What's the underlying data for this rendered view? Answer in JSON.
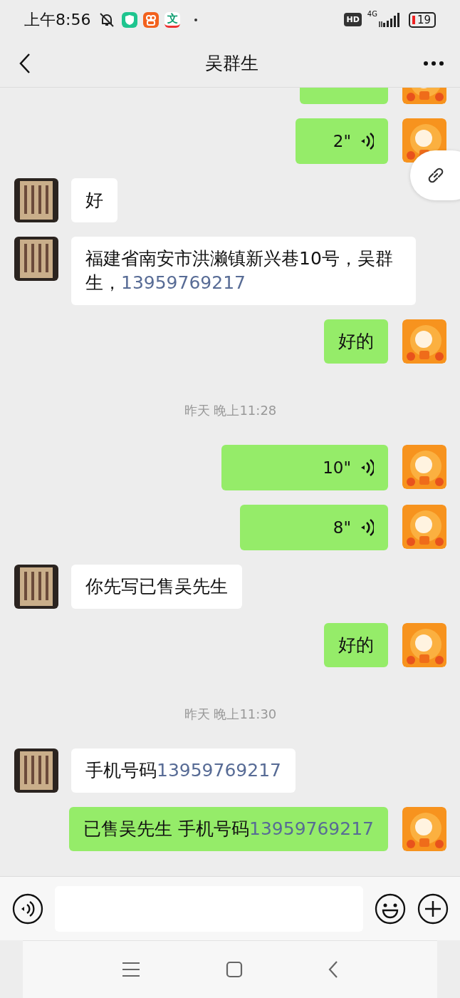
{
  "status_bar": {
    "time": "上午8:56",
    "app_badge": "文",
    "hd": "HD",
    "network": "4G",
    "battery": "19"
  },
  "header": {
    "title": "吴群生"
  },
  "messages": [
    {
      "outgoing": true,
      "kind": "clipped"
    },
    {
      "outgoing": true,
      "kind": "voice",
      "duration": "2\""
    },
    {
      "outgoing": false,
      "kind": "text",
      "text": "好"
    },
    {
      "outgoing": false,
      "kind": "text",
      "text": "福建省南安市洪濑镇新兴巷10号，吴群生，",
      "phone": "13959769217"
    },
    {
      "outgoing": true,
      "kind": "text",
      "text": "好的"
    },
    {
      "kind": "time",
      "text": "昨天 晚上11:28"
    },
    {
      "outgoing": true,
      "kind": "voice",
      "duration": "10\""
    },
    {
      "outgoing": true,
      "kind": "voice",
      "duration": "8\""
    },
    {
      "outgoing": false,
      "kind": "text",
      "text": "你先写已售吴先生"
    },
    {
      "outgoing": true,
      "kind": "text",
      "text": "好的"
    },
    {
      "kind": "time",
      "text": "昨天 晚上11:30"
    },
    {
      "outgoing": false,
      "kind": "text",
      "text": "手机号码",
      "phone": "13959769217"
    },
    {
      "outgoing": true,
      "kind": "text",
      "text": "已售吴先生 手机号码",
      "phone": "13959769217"
    }
  ]
}
